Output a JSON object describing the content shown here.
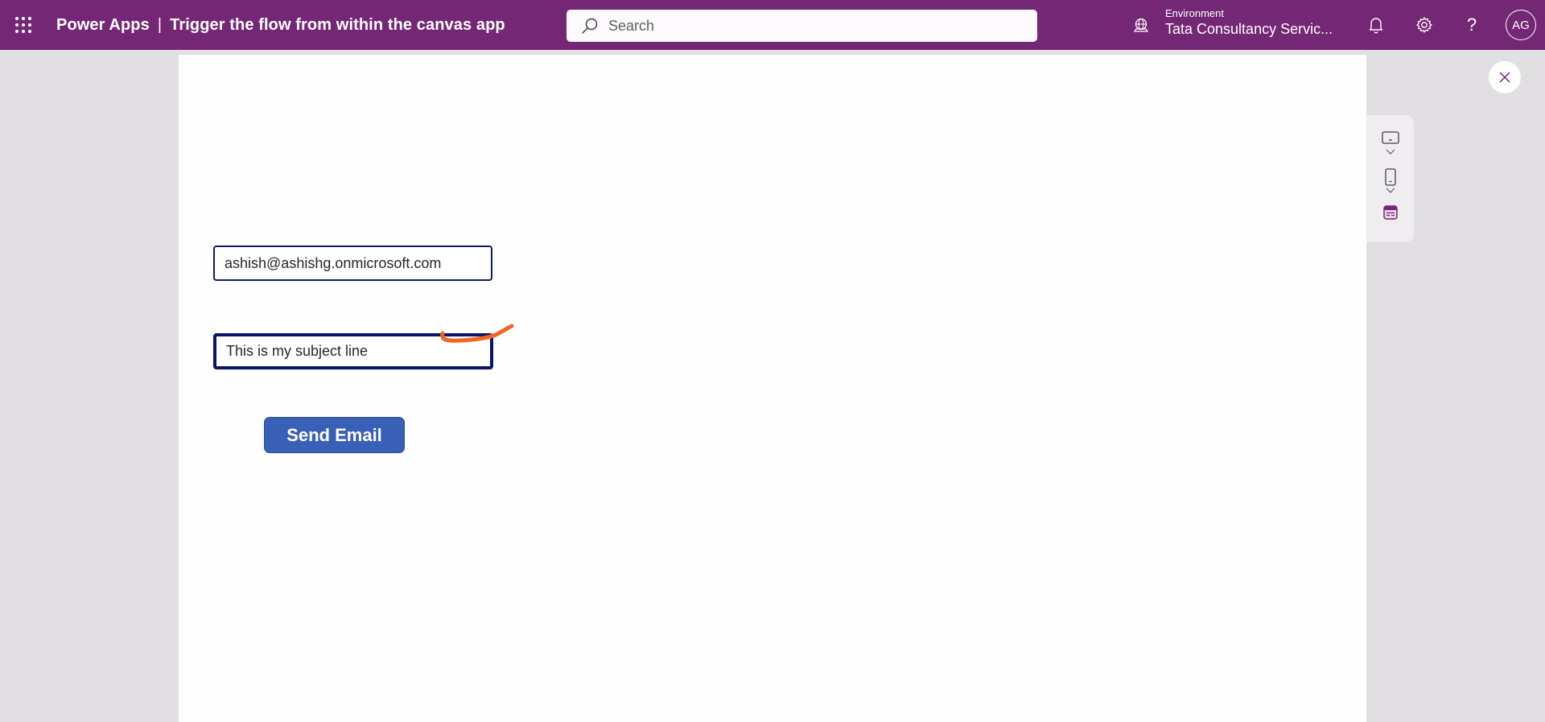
{
  "header": {
    "app_name": "Power Apps",
    "separator": "|",
    "app_title": "Trigger the flow from within the canvas app",
    "search_placeholder": "Search",
    "environment_label": "Environment",
    "environment_value": "Tata Consultancy Servic...",
    "avatar_initials": "AG",
    "help_glyph": "?",
    "icons": [
      "waffle-icon",
      "search-icon",
      "environment-icon",
      "bell-icon",
      "gear-icon",
      "help-icon"
    ],
    "brand_color": "#742774"
  },
  "canvas": {
    "email_field": {
      "value": "ashish@ashishg.onmicrosoft.com"
    },
    "subject_field": {
      "value": "This is my subject line"
    },
    "send_button": {
      "label": "Send Email",
      "color": "#3960b7"
    },
    "annotation_color": "#f26522"
  },
  "side_panel": {
    "items": [
      {
        "name": "tablet-view",
        "icon": "tablet-icon"
      },
      {
        "name": "tablet-options",
        "icon": "chevron-down-icon"
      },
      {
        "name": "phone-view",
        "icon": "phone-icon"
      },
      {
        "name": "phone-options",
        "icon": "chevron-down-icon"
      },
      {
        "name": "web-view",
        "icon": "web-layout-icon",
        "active": true
      }
    ]
  },
  "close_button": {
    "icon": "close-icon"
  }
}
